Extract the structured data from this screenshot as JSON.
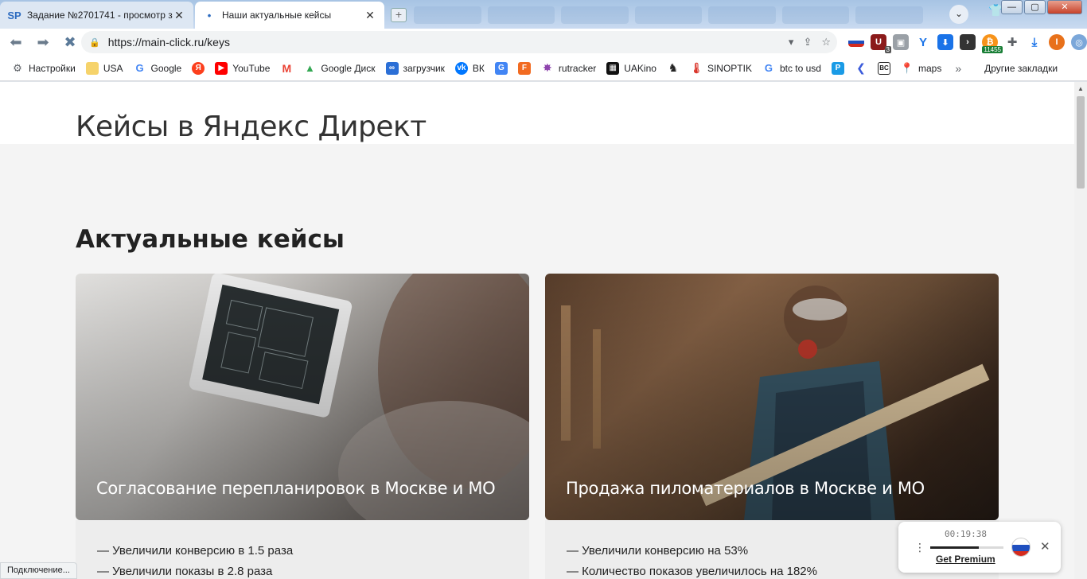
{
  "browser": {
    "tabs": [
      {
        "label": "Задание №2701741 - просмотр з",
        "favicon": "SP",
        "active": false
      },
      {
        "label": "Наши актуальные кейсы",
        "favicon": "•",
        "active": true
      }
    ],
    "url": "https://main-click.ru/keys",
    "window_controls": {
      "minimize": "—",
      "maximize": "▢",
      "close": "✕"
    },
    "extensions": {
      "badge_3": "3",
      "badge_btc": "11455",
      "profile_initial": "I"
    },
    "bookmarks": [
      {
        "label": "Настройки",
        "icon": "gear-icon"
      },
      {
        "label": "USA",
        "icon": "folder-icon"
      },
      {
        "label": "Google",
        "icon": "google-icon"
      },
      {
        "label": "",
        "icon": "yandex-icon"
      },
      {
        "label": "YouTube",
        "icon": "youtube-icon"
      },
      {
        "label": "",
        "icon": "gmail-icon"
      },
      {
        "label": "Google Диск",
        "icon": "drive-icon"
      },
      {
        "label": "загрузчик",
        "icon": "infinity-icon"
      },
      {
        "label": "ВК",
        "icon": "vk-icon"
      },
      {
        "label": "",
        "icon": "translate-icon"
      },
      {
        "label": "",
        "icon": "f-icon"
      },
      {
        "label": "rutracker",
        "icon": "star-icon"
      },
      {
        "label": "UAKino",
        "icon": "film-icon"
      },
      {
        "label": "",
        "icon": "chess-icon"
      },
      {
        "label": "SINOPTIK",
        "icon": "thermometer-icon"
      },
      {
        "label": "btc to usd",
        "icon": "google-icon"
      },
      {
        "label": "",
        "icon": "p-icon"
      },
      {
        "label": "",
        "icon": "arrow-icon"
      },
      {
        "label": "",
        "icon": "bc-icon"
      },
      {
        "label": "maps",
        "icon": "maps-pin-icon"
      }
    ],
    "bookmarks_more": "»",
    "other_bookmarks": "Другие закладки",
    "status_text": "Подключение..."
  },
  "page": {
    "hero_title": "Кейсы в Яндекс Директ",
    "section_title": "Актуальные кейсы",
    "cards": [
      {
        "title": "Согласование перепланировок в Москве и МО",
        "lines": [
          {
            "prefix": "— Увеличили конверсию в ",
            "value": "1.5",
            "suffix": " раза"
          },
          {
            "prefix": "— Увеличили показы в ",
            "value": "2.8",
            "suffix": " раза"
          }
        ]
      },
      {
        "title": "Продажа пиломатериалов в Москве и МО",
        "lines": [
          {
            "prefix": "— Увеличили конверсию на ",
            "value": "53%",
            "suffix": ""
          },
          {
            "prefix": "— Количество показов увеличилось на ",
            "value": "182%",
            "suffix": ""
          }
        ]
      }
    ]
  },
  "vpn_widget": {
    "timer": "00:19:38",
    "progress": 0.66,
    "premium_label": "Get Premium",
    "country_flag": "russia-flag-icon"
  },
  "colors": {
    "page_bg": "#f4f4f4",
    "text_dark": "#222222"
  }
}
